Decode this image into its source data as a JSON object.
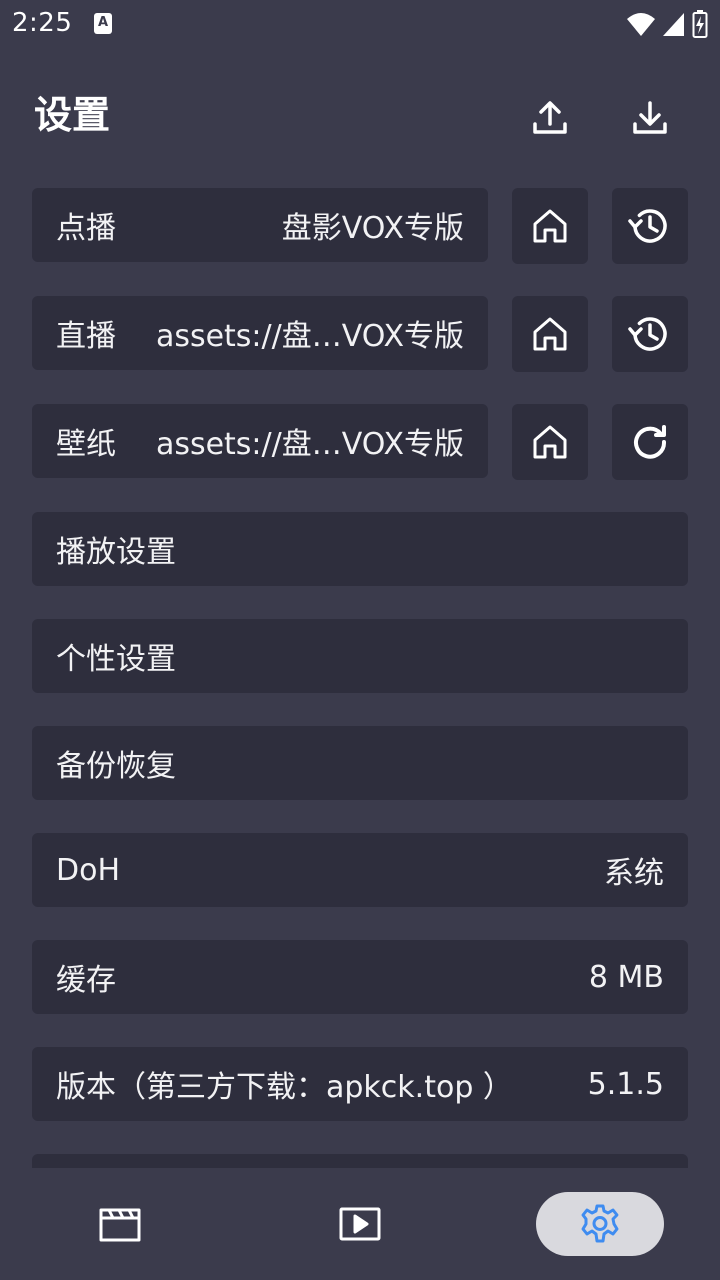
{
  "status_bar": {
    "time": "2:25",
    "notification_letter": "A"
  },
  "header": {
    "title": "设置"
  },
  "rows": {
    "vod": {
      "label": "点播",
      "value": "盘影VOX专版"
    },
    "live": {
      "label": "直播",
      "value": "assets://盘…VOX专版"
    },
    "wallpaper": {
      "label": "壁纸",
      "value": "assets://盘…VOX专版"
    },
    "player_settings": {
      "label": "播放设置"
    },
    "personal_settings": {
      "label": "个性设置"
    },
    "backup_restore": {
      "label": "备份恢复"
    },
    "doh": {
      "label": "DoH",
      "value": "系统"
    },
    "cache": {
      "label": "缓存",
      "value": "8 MB"
    },
    "version": {
      "label": "版本（第三方下载：apkck.top ）",
      "value": "5.1.5"
    }
  },
  "icons": {
    "upload": "upload-icon",
    "download": "download-icon",
    "home": "home-icon",
    "history": "history-icon",
    "refresh": "refresh-icon",
    "nav_vod": "clapperboard-icon",
    "nav_live": "play-box-icon",
    "nav_settings": "gear-icon"
  },
  "colors": {
    "background": "#3b3b4c",
    "card": "#2e2e3d",
    "accent": "#3f8cf0",
    "nav_active": "#d9d9de"
  }
}
